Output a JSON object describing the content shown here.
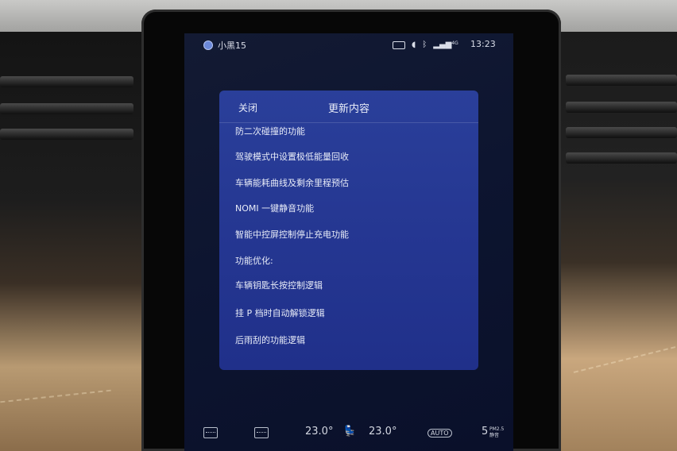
{
  "status_bar": {
    "profile_name": "小黑15",
    "network": "4G",
    "time": "13:23",
    "icons": [
      "profile-icon",
      "camera-icon",
      "speaker-icon",
      "bluetooth-icon",
      "signal-icon"
    ]
  },
  "dialog": {
    "close_label": "关闭",
    "title": "更新内容",
    "lines": [
      "防二次碰撞的功能",
      "驾驶模式中设置极低能量回收",
      "车辆能耗曲线及剩余里程预估",
      "NOMI 一键静音功能",
      "智能中控屏控制停止充电功能",
      "功能优化:",
      "车辆钥匙长按控制逻辑",
      "挂 P 档时自动解锁逻辑",
      "后雨刮的功能逻辑"
    ]
  },
  "climate": {
    "left_temp": "23.0°",
    "right_temp": "23.0°",
    "auto_label": "AUTO",
    "aqi_value": "5",
    "aqi_unit": "PM2.5",
    "aqi_status": "静音"
  },
  "colors": {
    "dialog_bg": "#253792",
    "screen_bg": "#0d1530",
    "text": "#e8ecf8"
  }
}
